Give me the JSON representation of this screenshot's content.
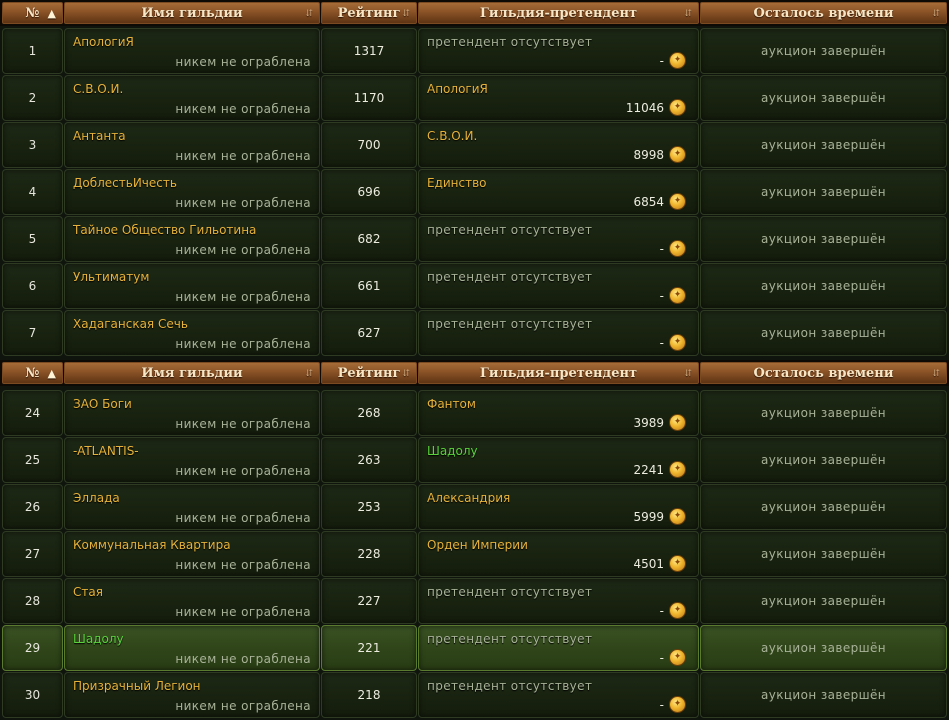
{
  "header": {
    "num": "№",
    "name": "Имя гильдии",
    "rating": "Рейтинг",
    "pretender": "Гильдия-претендент",
    "time": "Осталось времени"
  },
  "top_rows": [
    {
      "num": "1",
      "name": "АпологиЯ",
      "robbed": "никем не ограблена",
      "rating": "1317",
      "pretender": "претендент отсутствует",
      "pretender_none": true,
      "bid": "-",
      "time": "аукцион завершён"
    },
    {
      "num": "2",
      "name": "С.В.О.И.",
      "robbed": "никем не ограблена",
      "rating": "1170",
      "pretender": "АпологиЯ",
      "pretender_none": false,
      "bid": "11046",
      "time": "аукцион завершён"
    },
    {
      "num": "3",
      "name": "Антанта",
      "robbed": "никем не ограблена",
      "rating": "700",
      "pretender": "С.В.О.И.",
      "pretender_none": false,
      "bid": "8998",
      "time": "аукцион завершён"
    },
    {
      "num": "4",
      "name": "ДоблестьИчесть",
      "robbed": "никем не ограблена",
      "rating": "696",
      "pretender": "Единство",
      "pretender_none": false,
      "bid": "6854",
      "time": "аукцион завершён"
    },
    {
      "num": "5",
      "name": "Тайное Общество Гильотина",
      "robbed": "никем не ограблена",
      "rating": "682",
      "pretender": "претендент отсутствует",
      "pretender_none": true,
      "bid": "-",
      "time": "аукцион завершён"
    },
    {
      "num": "6",
      "name": "Ультиматум",
      "robbed": "никем не ограблена",
      "rating": "661",
      "pretender": "претендент отсутствует",
      "pretender_none": true,
      "bid": "-",
      "time": "аукцион завершён"
    },
    {
      "num": "7",
      "name": "Хадаганская Сечь",
      "robbed": "никем не ограблена",
      "rating": "627",
      "pretender": "претендент отсутствует",
      "pretender_none": true,
      "bid": "-",
      "time": "аукцион завершён"
    }
  ],
  "bottom_rows": [
    {
      "num": "24",
      "name": "ЗАО Боги",
      "robbed": "никем не ограблена",
      "rating": "268",
      "pretender": "Фантом",
      "pretender_none": false,
      "bid": "3989",
      "time": "аукцион завершён"
    },
    {
      "num": "25",
      "name": "-ATLANTIS-",
      "robbed": "никем не ограблена",
      "rating": "263",
      "pretender": "Шадолу",
      "pretender_none": false,
      "pretender_green": true,
      "bid": "2241",
      "time": "аукцион завершён"
    },
    {
      "num": "26",
      "name": "Эллада",
      "robbed": "никем не ограблена",
      "rating": "253",
      "pretender": "Александрия",
      "pretender_none": false,
      "bid": "5999",
      "time": "аукцион завершён"
    },
    {
      "num": "27",
      "name": "Коммунальная Квартира",
      "robbed": "никем не ограблена",
      "rating": "228",
      "pretender": "Орден Империи",
      "pretender_none": false,
      "bid": "4501",
      "time": "аукцион завершён"
    },
    {
      "num": "28",
      "name": "Стая",
      "robbed": "никем не ограблена",
      "rating": "227",
      "pretender": "претендент отсутствует",
      "pretender_none": true,
      "bid": "-",
      "time": "аукцион завершён"
    },
    {
      "num": "29",
      "name": "Шадолу",
      "name_green": true,
      "highlighted": true,
      "robbed": "никем не ограблена",
      "rating": "221",
      "pretender": "претендент отсутствует",
      "pretender_none": true,
      "bid": "-",
      "time": "аукцион завершён"
    },
    {
      "num": "30",
      "name": "Призрачный Легион",
      "robbed": "никем не ограблена",
      "rating": "218",
      "pretender": "претендент отсутствует",
      "pretender_none": true,
      "bid": "-",
      "time": "аукцион завершён"
    }
  ],
  "colors": {
    "guild_name": "#e6b23a",
    "own_guild": "#5ad23c",
    "muted_text": "#a8b298",
    "header_bg": "#8a5226"
  },
  "icons": {
    "sort_asc": "arrow-up-icon",
    "sort": "sort-icon",
    "currency": "gold-coin-icon"
  }
}
